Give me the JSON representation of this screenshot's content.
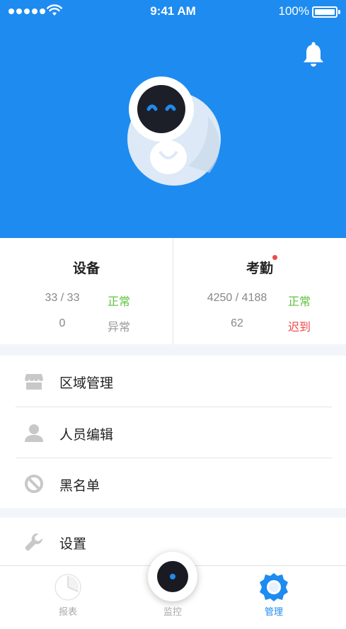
{
  "status_bar": {
    "time": "9:41 AM",
    "battery": "100%"
  },
  "colors": {
    "brand_blue": "#1E8BF0",
    "normal_green": "#5DC33E",
    "late_red": "#F04848",
    "muted_gray": "#888888"
  },
  "stats": {
    "device": {
      "title": "设备",
      "row1_value": "33 / 33",
      "row1_label": "正常",
      "row2_value": "0",
      "row2_label": "异常"
    },
    "attendance": {
      "title": "考勤",
      "row1_value": "4250 / 4188",
      "row1_label": "正常",
      "row2_value": "62",
      "row2_label": "迟到"
    }
  },
  "menu": {
    "area": {
      "label": "区域管理",
      "icon": "store-icon"
    },
    "people": {
      "label": "人员编辑",
      "icon": "person-icon"
    },
    "blacklist": {
      "label": "黑名单",
      "icon": "ban-icon"
    },
    "settings": {
      "label": "设置",
      "icon": "wrench-icon"
    }
  },
  "tabbar": {
    "report": "报表",
    "monitor": "监控",
    "manage": "管理"
  }
}
